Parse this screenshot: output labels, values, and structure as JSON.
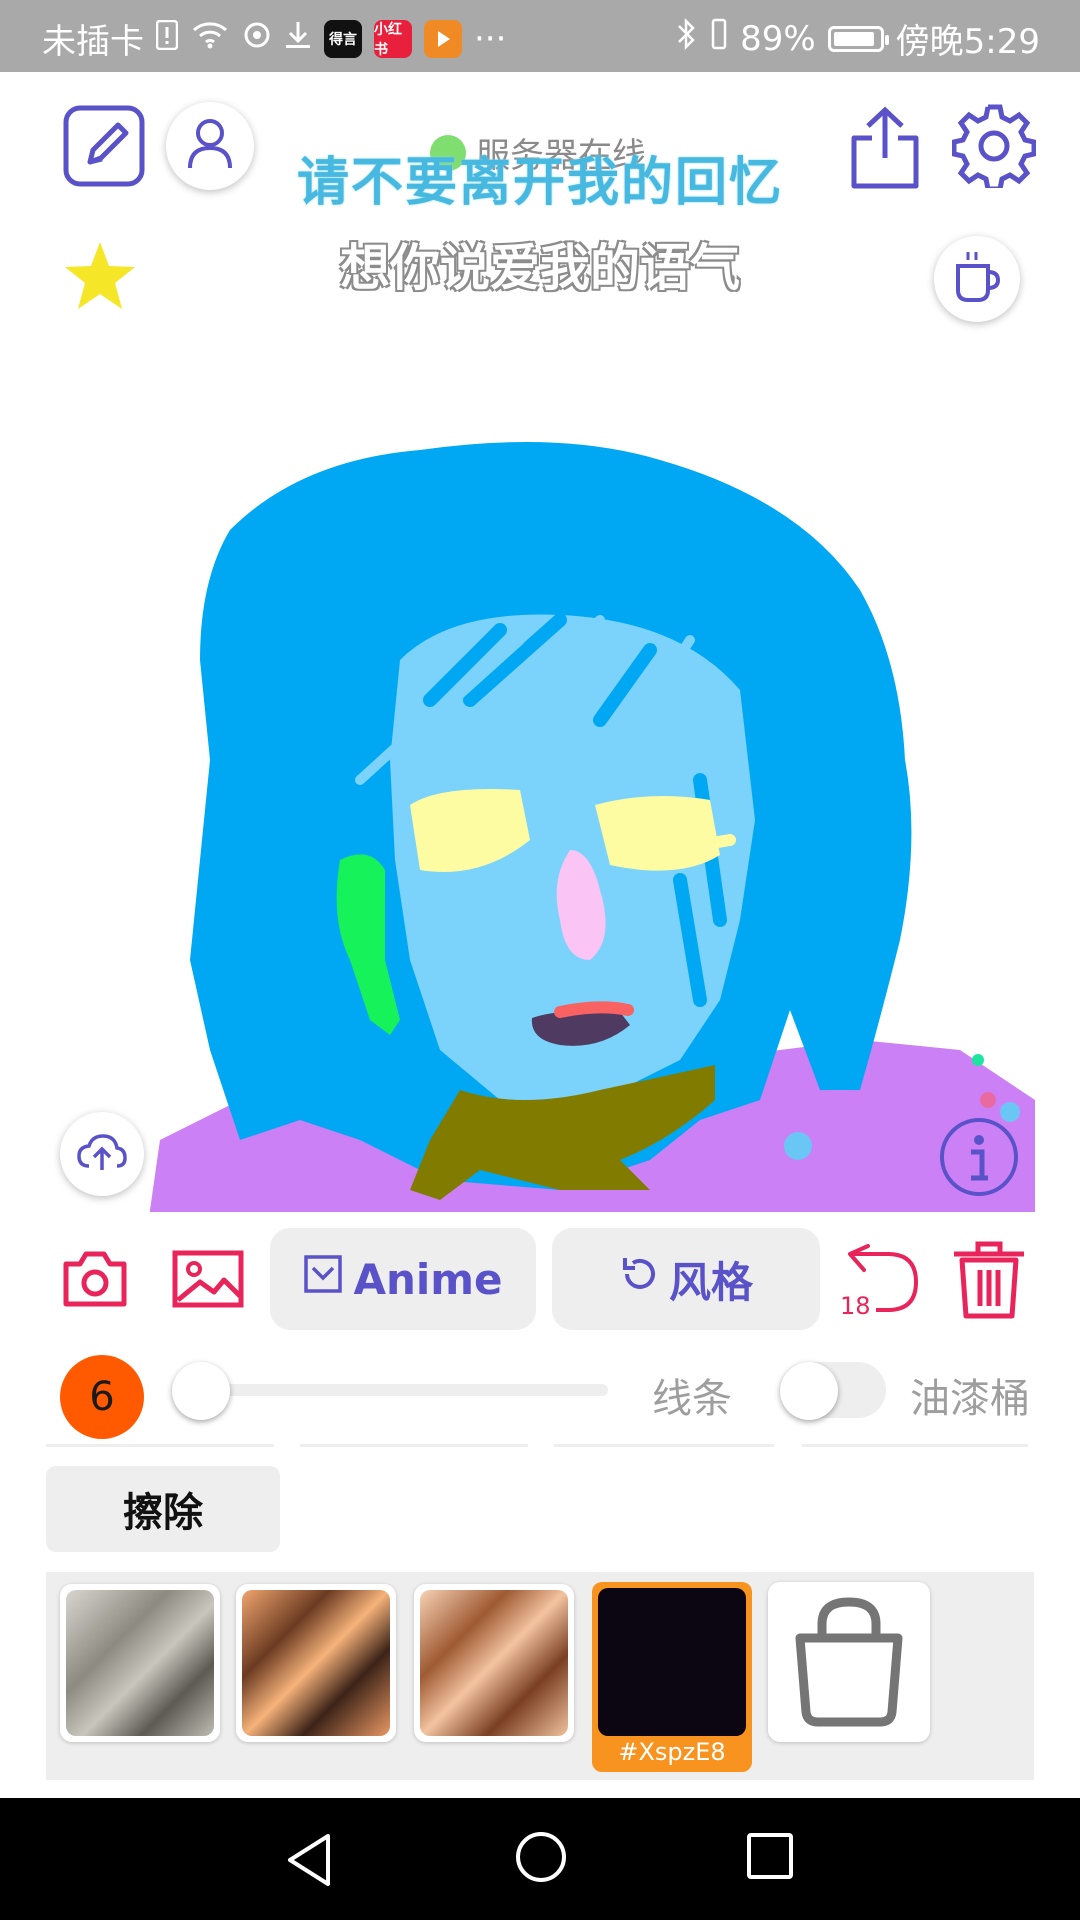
{
  "status_bar": {
    "carrier": "未插卡",
    "app_badges": [
      "得言",
      "小红书"
    ],
    "more": "···",
    "battery": "89%",
    "time": "傍晚5:29"
  },
  "header": {
    "server_status": "服务器在线",
    "lyric_line_1": "请不要离开我的回忆",
    "lyric_line_2": "想你说爱我的语气"
  },
  "icons": {
    "edit": "edit-icon",
    "user": "user-icon",
    "share": "share-icon",
    "settings": "gear-icon",
    "favorite": "star-icon",
    "coffee": "coffee-icon",
    "upload": "cloud-upload-icon",
    "info": "info-icon"
  },
  "toolbar": {
    "anime_label": "Anime",
    "style_label": "风格",
    "undo_count": "18"
  },
  "brush": {
    "size": "6",
    "size_level": 0.0,
    "line_label": "线条",
    "bucket_label": "油漆桶",
    "bucket_enabled": false
  },
  "erase_label": "擦除",
  "thumbnails": [
    {
      "name": "style-1"
    },
    {
      "name": "style-2"
    },
    {
      "name": "style-3"
    },
    {
      "name": "style-selected",
      "label": "#XspzE8"
    },
    {
      "name": "shop"
    }
  ],
  "colors": {
    "accent": "#5a52c8",
    "red": "#e8245a",
    "orange": "#ff5a00",
    "selected_border": "#f7931e"
  }
}
